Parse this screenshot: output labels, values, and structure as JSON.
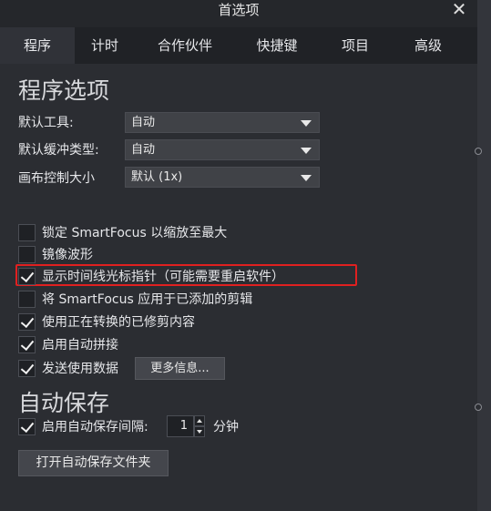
{
  "window": {
    "title": "首选项"
  },
  "tabs": [
    {
      "label": "程序",
      "active": true
    },
    {
      "label": "计时",
      "active": false
    },
    {
      "label": "合作伙伴",
      "active": false
    },
    {
      "label": "快捷键",
      "active": false
    },
    {
      "label": "项目",
      "active": false
    },
    {
      "label": "高级",
      "active": false
    }
  ],
  "program_options": {
    "heading": "程序选项",
    "fields": [
      {
        "label": "默认工具:",
        "value": "自动"
      },
      {
        "label": "默认缓冲类型:",
        "value": "自动"
      },
      {
        "label": "画布控制大小",
        "value": "默认 (1x)"
      }
    ],
    "checkboxes": [
      {
        "label": "锁定 SmartFocus 以缩放至最大",
        "checked": false
      },
      {
        "label": "镜像波形",
        "checked": false
      },
      {
        "label": "显示时间线光标指针（可能需要重启软件）",
        "checked": true
      },
      {
        "label": "将 SmartFocus 应用于已添加的剪辑",
        "checked": false
      },
      {
        "label": "使用正在转换的已修剪内容",
        "checked": true
      },
      {
        "label": "启用自动拼接",
        "checked": true
      },
      {
        "label": "发送使用数据",
        "checked": true
      }
    ],
    "more_info_button": "更多信息..."
  },
  "autosave": {
    "heading": "自动保存",
    "interval_label": "启用自动保存间隔:",
    "interval_checked": true,
    "interval_value": "1",
    "unit": "分钟",
    "open_folder_button": "打开自动保存文件夹"
  },
  "colors": {
    "highlight": "#e02020",
    "background": "#2b2d32"
  }
}
